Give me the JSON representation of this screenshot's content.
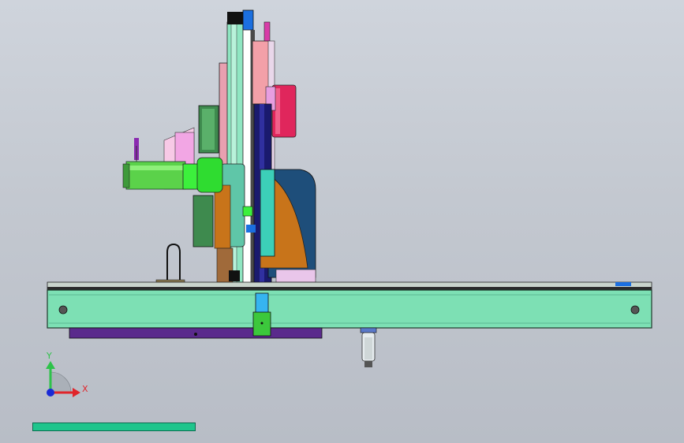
{
  "triad": {
    "y_label": "Y",
    "x_label": "X",
    "y_color": "#2ec24a",
    "x_color": "#e0242a",
    "z_color": "#1a2ad6"
  },
  "colors": {
    "background": "#c6cbd3",
    "beam": "#7de0b4",
    "beam_edge": "#1f3b2c",
    "underplate": "#5a2a8c",
    "column": "#8fe6c2",
    "column_dark": "#1a1a6e",
    "motor_block": "#e0265c",
    "pink_plate": "#f3a0a8",
    "orange_sector": "#c8741a",
    "navy_cover": "#1e4e7a",
    "gripper_green": "#5bd24a",
    "bright_green": "#3cf03c",
    "dark_green": "#3e8a4e",
    "teal": "#3ccfb8",
    "light_blue": "#36b4f0",
    "status_bar": "#1fc58c"
  }
}
